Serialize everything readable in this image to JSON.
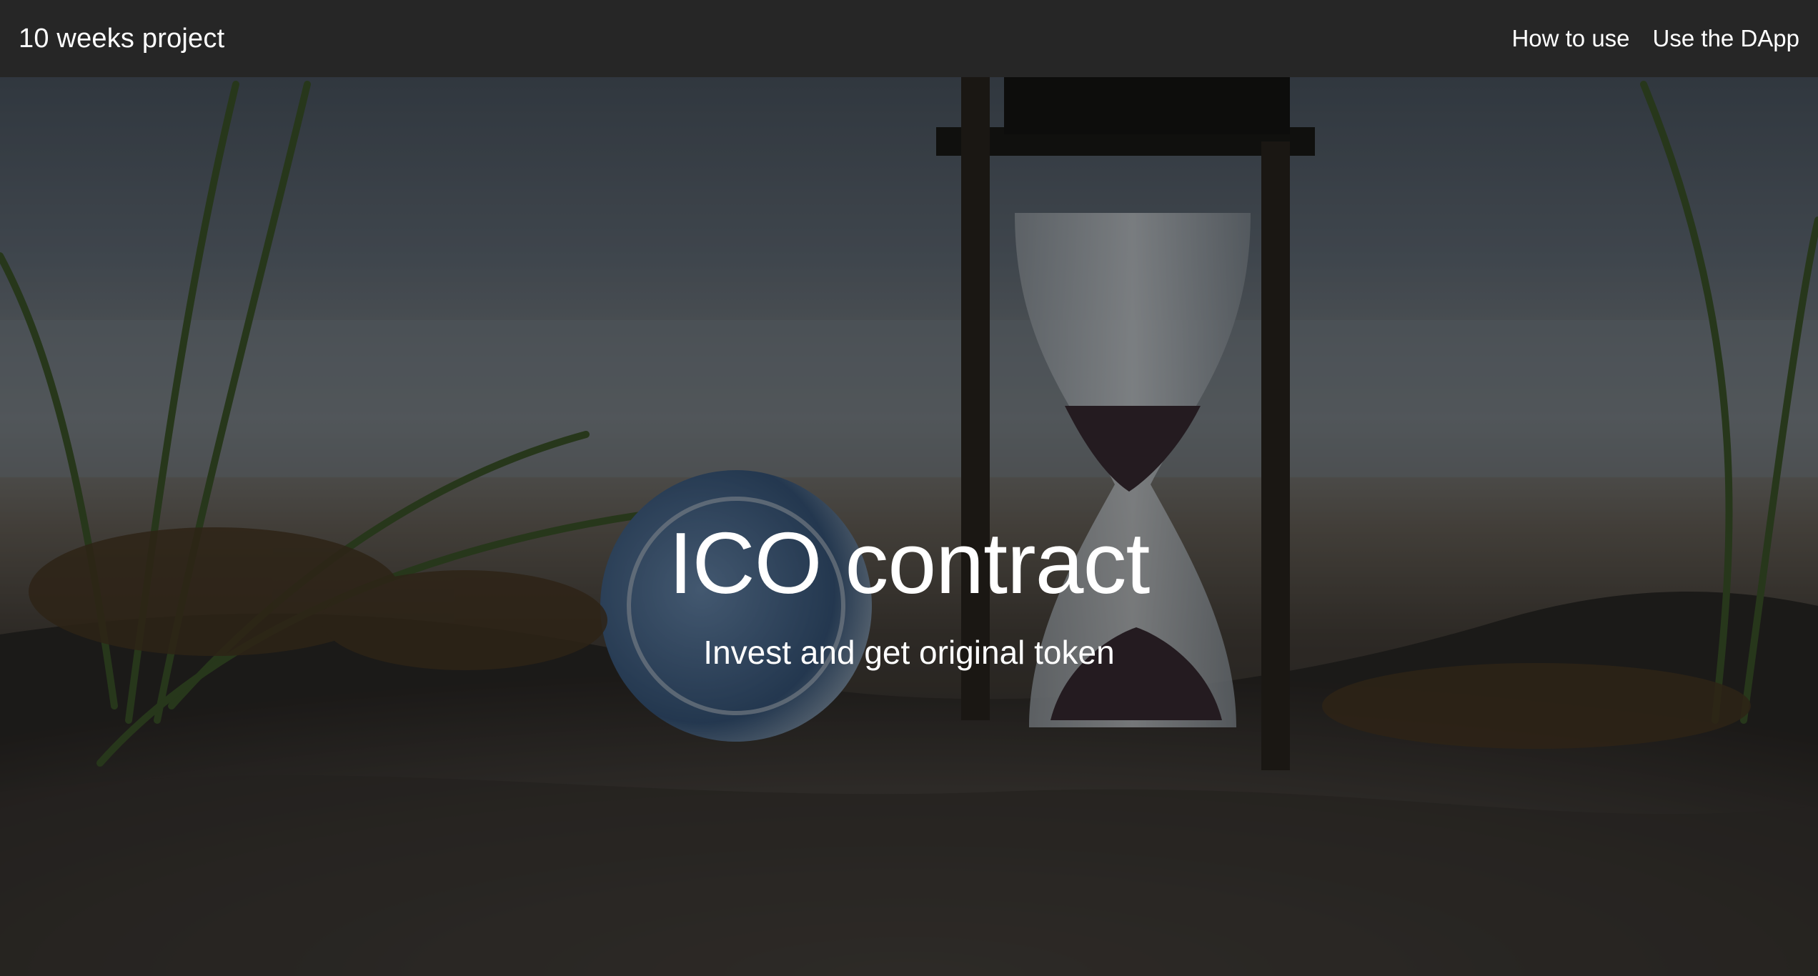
{
  "navbar": {
    "brand": "10 weeks project",
    "links": [
      {
        "label": "How to use"
      },
      {
        "label": "Use the DApp"
      }
    ],
    "background": "#262626"
  },
  "hero": {
    "title": "ICO contract",
    "subtitle": "Invest and get original token",
    "background_image": "hourglass-and-coin-on-beach-photo"
  }
}
